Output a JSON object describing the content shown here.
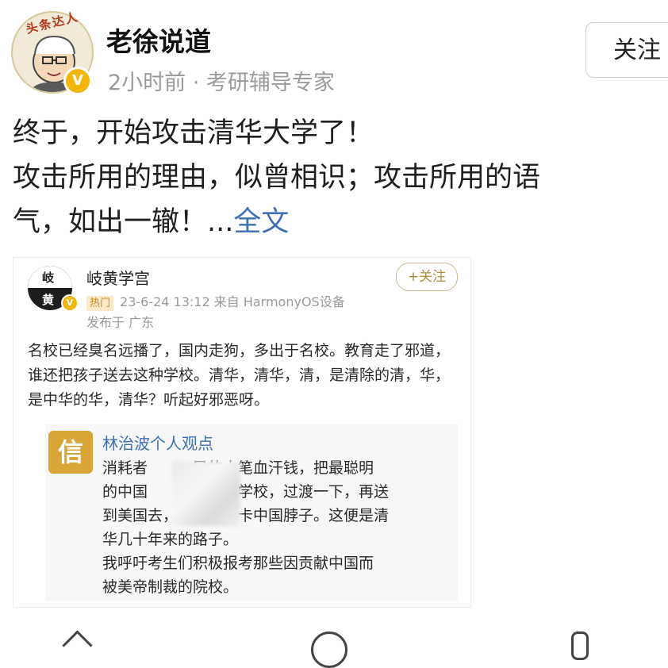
{
  "author": {
    "avatar_ribbon": "头条达人",
    "verified_badge": "V",
    "name": "老徐说道",
    "meta": "2小时前 · 考研辅导专家",
    "follow_label": "关注"
  },
  "post": {
    "lines": [
      "终于，开始攻击清华大学了！",
      "攻击所用的理由，似曾相识；攻击所用的语",
      "气，如出一辙！..."
    ],
    "full_text_link": "全文"
  },
  "embed": {
    "avatar_top_char": "岐",
    "avatar_bottom_char": "黄",
    "verified_badge": "V",
    "name": "岐黄学宫",
    "follow_label": "+关注",
    "hot_tag": "热门",
    "timestamp_source": "23-6-24 13:12  来自 HarmonyOS设备",
    "location": "发布于 广东",
    "text": "名校已经臭名远播了，国内走狗，多出于名校。教育走了邪道，谁还把孩子送去这种学校。清华，清华，清，是清除的清，华，是中华的华，清华？听起好邪恶呀。",
    "quote": {
      "icon_char": "信",
      "title": "林治波个人观点",
      "line1": "消耗者　　　民的大笔血汗钱，把最聪明",
      "line2": "的中国　　　到自己学校，过渡一下，再送",
      "line3": "到美国去，带着美国卡中国脖子。这便是清",
      "line4": "华几十年来的路子。",
      "line5": "我呼吁考生们积极报考那些因贡献中国而",
      "line6": "被美帝制裁的院校。"
    }
  }
}
